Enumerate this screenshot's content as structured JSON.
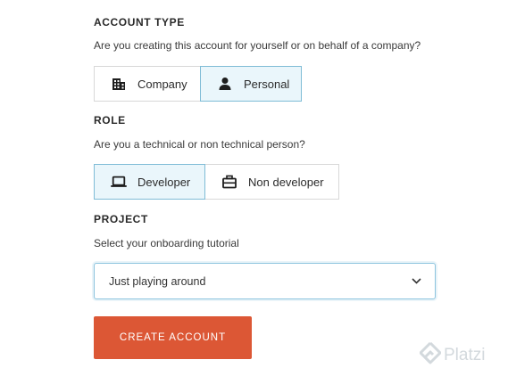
{
  "account_type": {
    "title": "ACCOUNT TYPE",
    "description": "Are you creating this account for yourself or on behalf of a company?",
    "options": [
      {
        "label": "Company",
        "icon": "building-icon",
        "selected": false
      },
      {
        "label": "Personal",
        "icon": "person-icon",
        "selected": true
      }
    ]
  },
  "role": {
    "title": "ROLE",
    "description": "Are you a technical or non technical person?",
    "options": [
      {
        "label": "Developer",
        "icon": "laptop-icon",
        "selected": true
      },
      {
        "label": "Non developer",
        "icon": "briefcase-icon",
        "selected": false
      }
    ]
  },
  "project": {
    "title": "PROJECT",
    "description": "Select your onboarding tutorial",
    "select_value": "Just playing around"
  },
  "create_button": {
    "label": "CREATE ACCOUNT"
  },
  "watermark": {
    "text": "Platzi"
  },
  "colors": {
    "accent_button": "#dc5735",
    "selected_bg": "#eaf6fb",
    "selected_border": "#7fbcd6",
    "watermark": "#d3d9dd"
  }
}
